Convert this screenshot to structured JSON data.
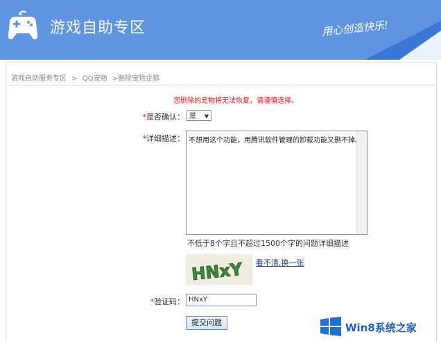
{
  "header": {
    "title": "游戏自助专区",
    "slogan": "用心创造快乐!"
  },
  "breadcrumb": [
    "游戏自助服务专区",
    ">",
    "QQ宠物",
    ">删除宠物企鹅"
  ],
  "warning": "您删除的宠物将无法恢复，请谨慎选择。",
  "form": {
    "confirm_label": "是否确认：",
    "confirm_value": "是",
    "desc_label": "详细描述：",
    "desc_value": "不想用这个功能，用腾讯软件管理的卸载功能又删不掉。",
    "hint": "不低于8个字且不超过1500个字的问题详细描述",
    "captcha_image_text": "HNxY",
    "refresh_link": "看不清,换一张",
    "captcha_label": "验证码：",
    "captcha_value": "HNxY",
    "submit_label": "提交问题",
    "required_mark": "*"
  },
  "watermark": "Win8系统之家",
  "colors": {
    "header_bg": "#5e94e0",
    "warning": "#e02020",
    "link": "#1a3fa8"
  }
}
